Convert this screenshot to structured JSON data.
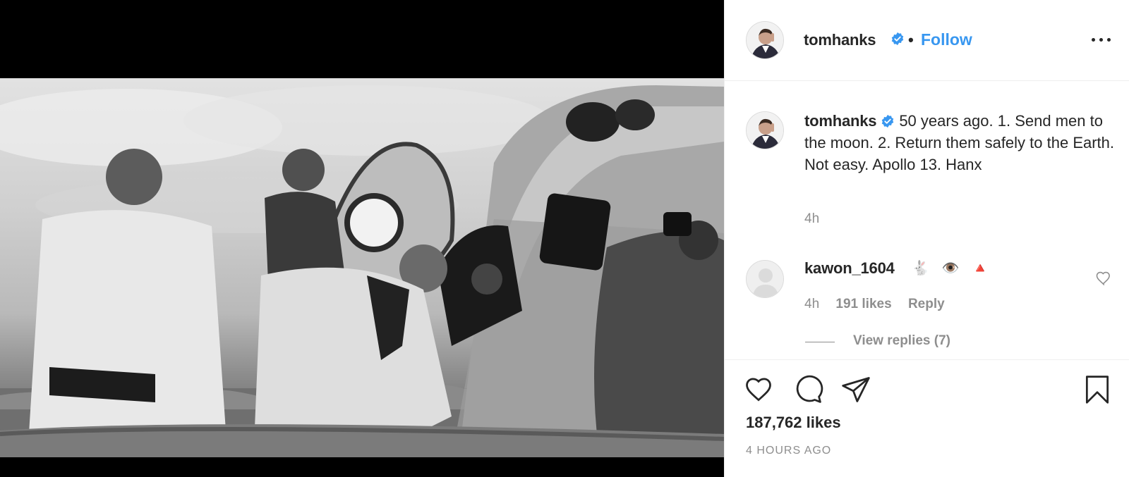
{
  "post": {
    "author": "tomhanks",
    "follow_label": "Follow",
    "separator": "•",
    "more_label": "More options",
    "photo_alt": "Black and white photo of Apollo 13 crew exiting the command module after splashdown"
  },
  "caption": {
    "username": "tomhanks",
    "text": "50 years ago. 1.  Send men to the moon. 2.  Return them safely to the Earth. Not easy. Apollo 13. Hanx",
    "time": "4h"
  },
  "comments": [
    {
      "username": "kawon_1604",
      "text": "🐇 👁️ 🔺",
      "time": "4h",
      "likes": "191 likes",
      "reply_label": "Reply",
      "view_replies": "View replies (7)"
    }
  ],
  "footer": {
    "likes": "187,762 likes",
    "timestamp": "4 HOURS AGO"
  },
  "icons": {
    "verified": "verified-badge-icon",
    "like": "heart-icon",
    "comment": "comment-bubble-icon",
    "share": "paper-plane-icon",
    "save": "bookmark-icon",
    "more": "ellipsis-icon"
  },
  "colors": {
    "link": "#3897f0",
    "verified": "#3897f0",
    "muted": "#8e8e8e",
    "text": "#262626"
  }
}
